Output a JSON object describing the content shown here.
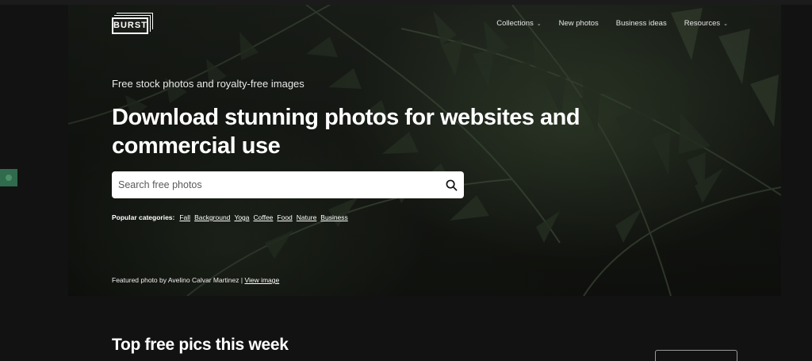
{
  "brand": {
    "logo_text": "BURST"
  },
  "nav": {
    "items": [
      {
        "label": "Collections",
        "has_dropdown": true
      },
      {
        "label": "New photos",
        "has_dropdown": false
      },
      {
        "label": "Business ideas",
        "has_dropdown": false
      },
      {
        "label": "Resources",
        "has_dropdown": true
      }
    ]
  },
  "hero": {
    "subtitle": "Free stock photos and royalty-free images",
    "headline": "Download stunning photos for websites and commercial use",
    "search_placeholder": "Search free photos",
    "popular_label": "Popular categories:",
    "categories": [
      "Fall",
      "Background",
      "Yoga",
      "Coffee",
      "Food",
      "Nature",
      "Business"
    ],
    "credit_text": "Featured photo by Avelino Calvar Martinez |",
    "credit_link": "View image"
  },
  "section": {
    "title": "Top free pics this week"
  },
  "colors": {
    "background": "#121212",
    "hero_overlay": "#171a15",
    "side_tab": "#2f6b4c"
  }
}
